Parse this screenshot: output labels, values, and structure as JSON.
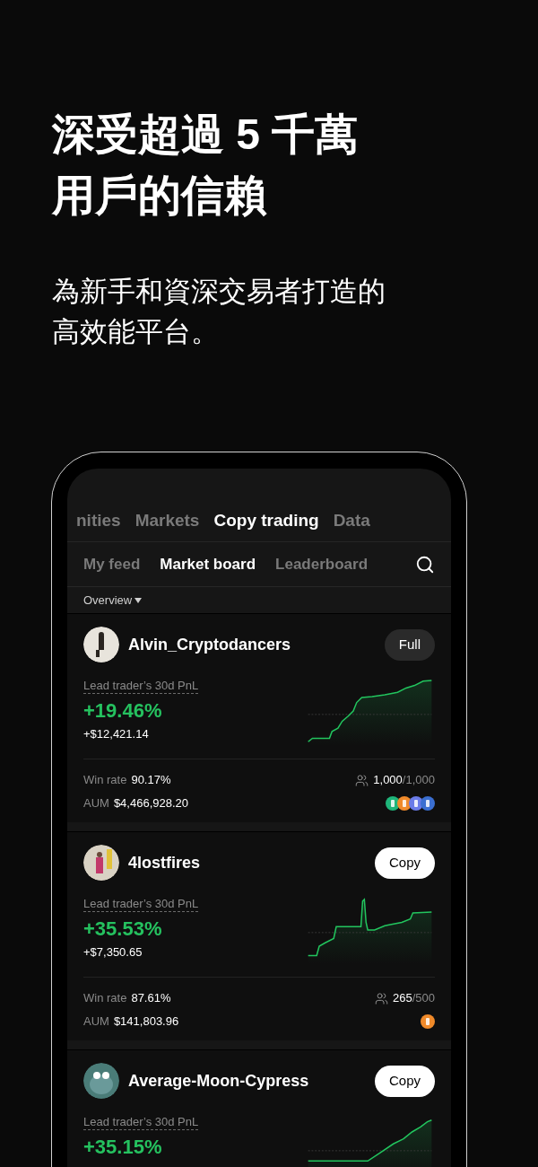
{
  "headline": [
    "深受超過 5 千萬",
    "用戶的信賴"
  ],
  "subtitle": [
    "為新手和資深交易者打造的",
    "高效能平台。"
  ],
  "top_tabs": [
    {
      "label": "nities",
      "selected": false
    },
    {
      "label": "Markets",
      "selected": false
    },
    {
      "label": "Copy trading",
      "selected": true
    },
    {
      "label": "Data",
      "selected": false
    }
  ],
  "sub_tabs": [
    {
      "label": "My feed",
      "selected": false
    },
    {
      "label": "Market board",
      "selected": true
    },
    {
      "label": "Leaderboard",
      "selected": false
    }
  ],
  "filter": "Overview",
  "traders": [
    {
      "name": "Alvin_Cryptodancers",
      "button": {
        "kind": "full",
        "label": "Full"
      },
      "pnl_label": "Lead trader’s 30d PnL",
      "pnl_pct": "+19.46%",
      "pnl_amount": "+$12,421.14",
      "win_rate_label": "Win rate",
      "win_rate": "90.17%",
      "aum_label": "AUM",
      "aum": "$4,466,928.20",
      "copiers": "1,000",
      "capacity": "/1,000",
      "coins": [
        {
          "color": "#1fb57a"
        },
        {
          "color": "#f08a2a"
        },
        {
          "color": "#6a7be8"
        },
        {
          "color": "#3b6fd1"
        }
      ]
    },
    {
      "name": "4lostfires",
      "button": {
        "kind": "copy",
        "label": "Copy"
      },
      "pnl_label": "Lead trader’s 30d PnL",
      "pnl_pct": "+35.53%",
      "pnl_amount": "+$7,350.65",
      "win_rate_label": "Win rate",
      "win_rate": "87.61%",
      "aum_label": "AUM",
      "aum": "$141,803.96",
      "copiers": "265",
      "capacity": "/500",
      "coins": [
        {
          "color": "#f08a2a"
        }
      ]
    },
    {
      "name": "Average-Moon-Cypress",
      "button": {
        "kind": "copy",
        "label": "Copy"
      },
      "pnl_label": "Lead trader’s 30d PnL",
      "pnl_pct": "+35.15%"
    }
  ]
}
